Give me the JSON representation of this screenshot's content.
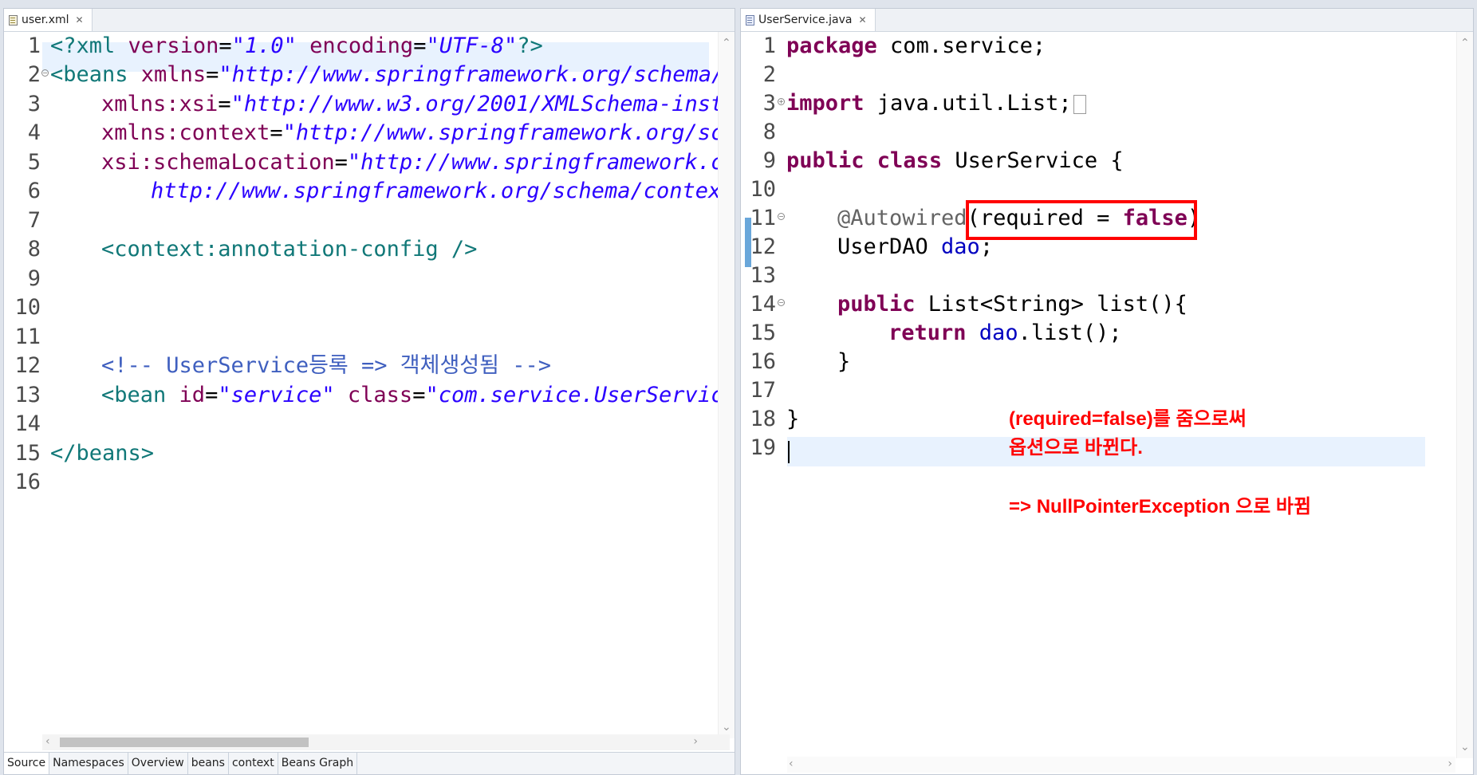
{
  "left_editor": {
    "tab_label": "user.xml",
    "line_numbers": [
      "1",
      "2",
      "3",
      "4",
      "5",
      "6",
      "7",
      "8",
      "9",
      "10",
      "11",
      "12",
      "13",
      "14",
      "15",
      "16"
    ],
    "code": {
      "l1_open": "<?xml ",
      "l1_attr1": "version",
      "l1_eq1": "=",
      "l1_val1": "\"1.0\"",
      "l1_attr2": " encoding",
      "l1_eq2": "=",
      "l1_val2": "\"UTF-8\"",
      "l1_close": "?>",
      "l2_tag": "<beans ",
      "l2_attr": "xmlns",
      "l2_eq": "=",
      "l2_val": "\"http://www.springframework.org/schema/",
      "l3_attr": "xmlns:xsi",
      "l3_eq": "=",
      "l3_val": "\"http://www.w3.org/2001/XMLSchema-inst",
      "l4_attr": "xmlns:context",
      "l4_eq": "=",
      "l4_val": "\"http://www.springframework.org/sc",
      "l5_attr": "xsi:schemaLocation",
      "l5_eq": "=",
      "l5_val": "\"http://www.springframework.c",
      "l6_val": "http://www.springframework.org/schema/contex",
      "l8_tag": "<context:annotation-config />",
      "l12_comment": "<!-- UserService등록 => 객체생성됨 -->",
      "l13_tag": "<bean ",
      "l13_attr1": "id",
      "l13_eq1": "=",
      "l13_val1": "\"service\"",
      "l13_attr2": " class",
      "l13_eq2": "=",
      "l13_val2": "\"com.service.UserServic",
      "l15_tag": "</beans>"
    },
    "bottom_tabs": [
      "Source",
      "Namespaces",
      "Overview",
      "beans",
      "context",
      "Beans Graph"
    ]
  },
  "right_editor": {
    "tab_label": "UserService.java",
    "line_numbers": [
      "1",
      "2",
      "3",
      "8",
      "9",
      "10",
      "11",
      "12",
      "13",
      "14",
      "15",
      "16",
      "17",
      "18",
      "19"
    ],
    "code": {
      "l1_kw": "package",
      "l1_rest": " com.service;",
      "l3_kw": "import",
      "l3_rest": " java.util.List;",
      "l9_kw1": "public",
      "l9_kw2": " class",
      "l9_rest": " UserService {",
      "l11_ann": "@Autowired",
      "l11_p1": "(required = ",
      "l11_kw": "false",
      "l11_p2": ")",
      "l12_type": "UserDAO ",
      "l12_field": "dao",
      "l12_semi": ";",
      "l14_kw": "public",
      "l14_rest": " List<String> list(){",
      "l15_kw": "return",
      "l15_field": " dao",
      "l15_rest": ".list();",
      "l16_brace": "}",
      "l18_brace": "}"
    }
  },
  "annotation": {
    "line1": "(required=false)를 줌으로써",
    "line2": "옵션으로 바뀐다.",
    "line3": "=> NullPointerException 으로 바뀜",
    "color": "#ff0000"
  },
  "icons": [
    "file-xml-icon",
    "file-java-icon",
    "close-icon",
    "fold-icon",
    "scroll-up-icon",
    "scroll-down-icon",
    "scroll-left-icon",
    "scroll-right-icon"
  ]
}
